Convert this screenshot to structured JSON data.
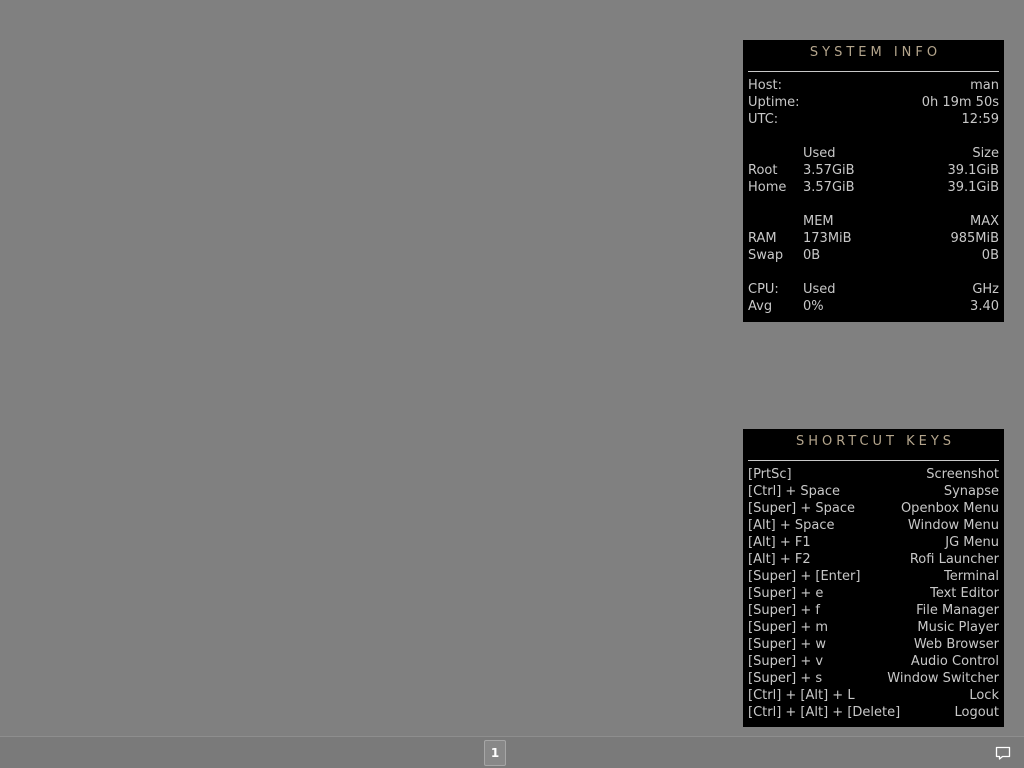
{
  "system_info": {
    "title": "SYSTEM INFO",
    "host_label": "Host:",
    "host_value": "man",
    "uptime_label": "Uptime:",
    "uptime_value": "0h 19m 50s",
    "utc_label": "UTC:",
    "utc_value": "12:59",
    "disk_header_used": "Used",
    "disk_header_size": "Size",
    "disks": [
      {
        "name": "Root",
        "used": "3.57GiB",
        "size": "39.1GiB"
      },
      {
        "name": "Home",
        "used": "3.57GiB",
        "size": "39.1GiB"
      }
    ],
    "mem_header_mem": "MEM",
    "mem_header_max": "MAX",
    "memory": [
      {
        "name": "RAM",
        "used": "173MiB",
        "max": "985MiB"
      },
      {
        "name": "Swap",
        "used": "0B",
        "max": "0B"
      }
    ],
    "cpu_label": "CPU:",
    "cpu_header_used": "Used",
    "cpu_header_ghz": "GHz",
    "cpu_avg_label": "Avg",
    "cpu_avg_used": "0%",
    "cpu_avg_ghz": "3.40"
  },
  "shortcut_keys": {
    "title": "SHORTCUT KEYS",
    "items": [
      {
        "keys": "[PrtSc]",
        "action": "Screenshot"
      },
      {
        "keys": "[Ctrl] + Space",
        "action": "Synapse"
      },
      {
        "keys": "[Super] + Space",
        "action": "Openbox Menu"
      },
      {
        "keys": "[Alt] + Space",
        "action": "Window Menu"
      },
      {
        "keys": "[Alt] + F1",
        "action": "JG Menu"
      },
      {
        "keys": "[Alt] + F2",
        "action": "Rofi Launcher"
      },
      {
        "keys": "[Super] + [Enter]",
        "action": "Terminal"
      },
      {
        "keys": "[Super] + e",
        "action": "Text Editor"
      },
      {
        "keys": "[Super] + f",
        "action": "File Manager"
      },
      {
        "keys": "[Super] + m",
        "action": "Music Player"
      },
      {
        "keys": "[Super] + w",
        "action": "Web Browser"
      },
      {
        "keys": "[Super] + v",
        "action": "Audio Control"
      },
      {
        "keys": "[Super] + s",
        "action": "Window Switcher"
      },
      {
        "keys": "[Ctrl] + [Alt] + L",
        "action": "Lock"
      },
      {
        "keys": "[Ctrl] + [Alt] + [Delete]",
        "action": "Logout"
      }
    ]
  },
  "taskbar": {
    "workspace_label": "1",
    "tray_icon": "notification-icon"
  },
  "colors": {
    "desktop_bg": "#808080",
    "panel_bg": "#000000",
    "panel_text": "#c8c8c8",
    "title_text": "#b4a58c"
  }
}
